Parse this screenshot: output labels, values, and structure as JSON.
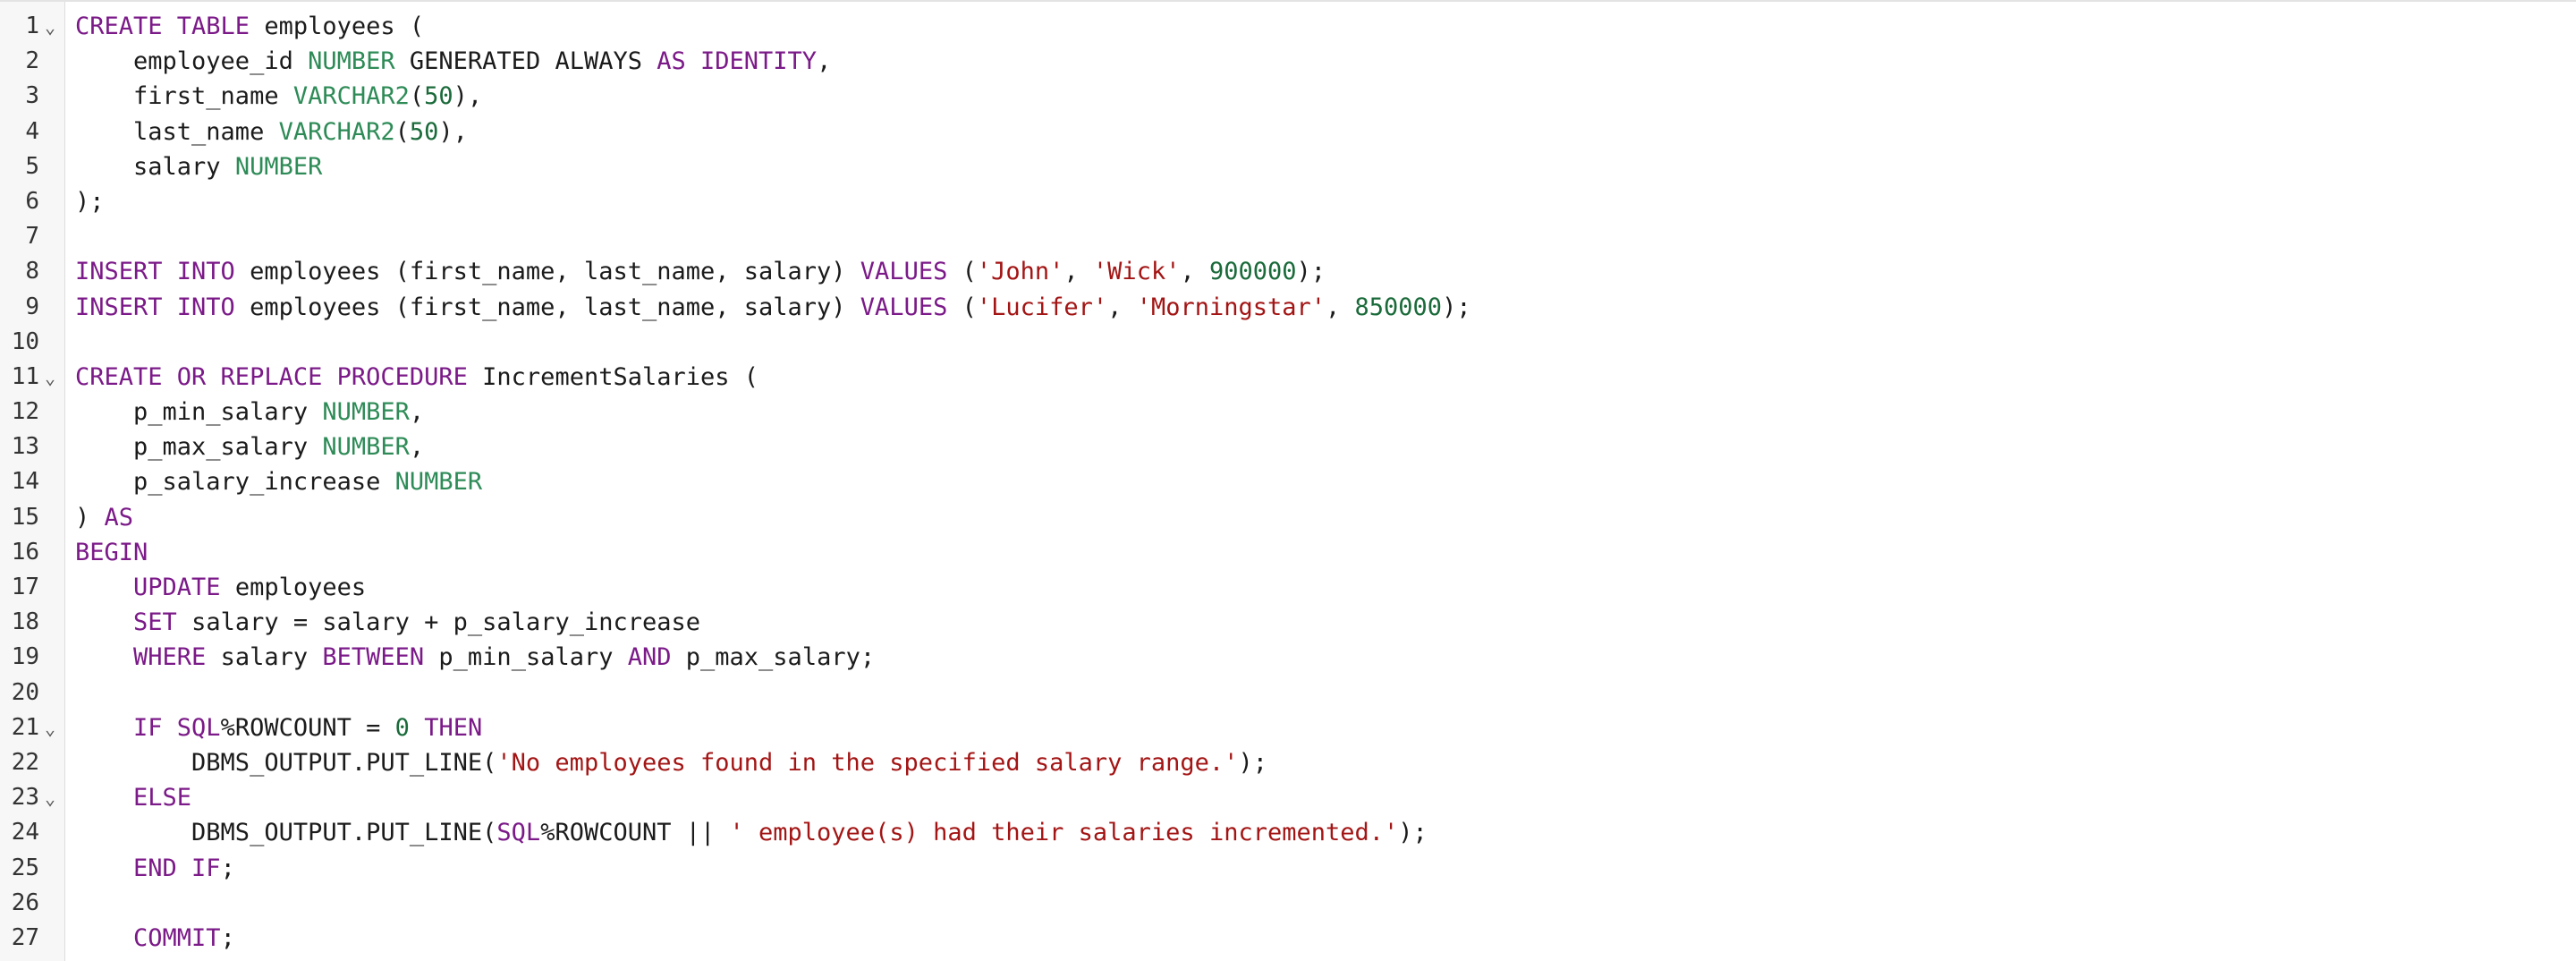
{
  "editor": {
    "fold_glyph": "⌄",
    "lines": [
      {
        "n": "1",
        "fold": true,
        "tokens": [
          {
            "t": "CREATE TABLE",
            "c": "kw"
          },
          {
            "t": " employees (",
            "c": ""
          }
        ]
      },
      {
        "n": "2",
        "fold": false,
        "tokens": [
          {
            "t": "    employee_id ",
            "c": ""
          },
          {
            "t": "NUMBER",
            "c": "ty"
          },
          {
            "t": " GENERATED ALWAYS ",
            "c": ""
          },
          {
            "t": "AS IDENTITY",
            "c": "kw"
          },
          {
            "t": ",",
            "c": ""
          }
        ]
      },
      {
        "n": "3",
        "fold": false,
        "tokens": [
          {
            "t": "    first_name ",
            "c": ""
          },
          {
            "t": "VARCHAR2",
            "c": "ty"
          },
          {
            "t": "(",
            "c": ""
          },
          {
            "t": "50",
            "c": "nu"
          },
          {
            "t": "),",
            "c": ""
          }
        ]
      },
      {
        "n": "4",
        "fold": false,
        "tokens": [
          {
            "t": "    last_name ",
            "c": ""
          },
          {
            "t": "VARCHAR2",
            "c": "ty"
          },
          {
            "t": "(",
            "c": ""
          },
          {
            "t": "50",
            "c": "nu"
          },
          {
            "t": "),",
            "c": ""
          }
        ]
      },
      {
        "n": "5",
        "fold": false,
        "tokens": [
          {
            "t": "    salary ",
            "c": ""
          },
          {
            "t": "NUMBER",
            "c": "ty"
          }
        ]
      },
      {
        "n": "6",
        "fold": false,
        "tokens": [
          {
            "t": ");",
            "c": ""
          }
        ]
      },
      {
        "n": "7",
        "fold": false,
        "tokens": []
      },
      {
        "n": "8",
        "fold": false,
        "tokens": [
          {
            "t": "INSERT INTO",
            "c": "kw"
          },
          {
            "t": " employees (first_name, last_name, salary) ",
            "c": ""
          },
          {
            "t": "VALUES",
            "c": "kw"
          },
          {
            "t": " (",
            "c": ""
          },
          {
            "t": "'John'",
            "c": "st"
          },
          {
            "t": ", ",
            "c": ""
          },
          {
            "t": "'Wick'",
            "c": "st"
          },
          {
            "t": ", ",
            "c": ""
          },
          {
            "t": "900000",
            "c": "nu"
          },
          {
            "t": ");",
            "c": ""
          }
        ]
      },
      {
        "n": "9",
        "fold": false,
        "tokens": [
          {
            "t": "INSERT INTO",
            "c": "kw"
          },
          {
            "t": " employees (first_name, last_name, salary) ",
            "c": ""
          },
          {
            "t": "VALUES",
            "c": "kw"
          },
          {
            "t": " (",
            "c": ""
          },
          {
            "t": "'Lucifer'",
            "c": "st"
          },
          {
            "t": ", ",
            "c": ""
          },
          {
            "t": "'Morningstar'",
            "c": "st"
          },
          {
            "t": ", ",
            "c": ""
          },
          {
            "t": "850000",
            "c": "nu"
          },
          {
            "t": ");",
            "c": ""
          }
        ]
      },
      {
        "n": "10",
        "fold": false,
        "tokens": []
      },
      {
        "n": "11",
        "fold": true,
        "tokens": [
          {
            "t": "CREATE OR REPLACE PROCEDURE",
            "c": "kw"
          },
          {
            "t": " IncrementSalaries (",
            "c": ""
          }
        ]
      },
      {
        "n": "12",
        "fold": false,
        "tokens": [
          {
            "t": "    p_min_salary ",
            "c": ""
          },
          {
            "t": "NUMBER",
            "c": "ty"
          },
          {
            "t": ",",
            "c": ""
          }
        ]
      },
      {
        "n": "13",
        "fold": false,
        "tokens": [
          {
            "t": "    p_max_salary ",
            "c": ""
          },
          {
            "t": "NUMBER",
            "c": "ty"
          },
          {
            "t": ",",
            "c": ""
          }
        ]
      },
      {
        "n": "14",
        "fold": false,
        "tokens": [
          {
            "t": "    p_salary_increase ",
            "c": ""
          },
          {
            "t": "NUMBER",
            "c": "ty"
          }
        ]
      },
      {
        "n": "15",
        "fold": false,
        "tokens": [
          {
            "t": ") ",
            "c": ""
          },
          {
            "t": "AS",
            "c": "kw"
          }
        ]
      },
      {
        "n": "16",
        "fold": false,
        "tokens": [
          {
            "t": "BEGIN",
            "c": "kw"
          }
        ]
      },
      {
        "n": "17",
        "fold": false,
        "tokens": [
          {
            "t": "    ",
            "c": ""
          },
          {
            "t": "UPDATE",
            "c": "kw"
          },
          {
            "t": " employees",
            "c": ""
          }
        ]
      },
      {
        "n": "18",
        "fold": false,
        "tokens": [
          {
            "t": "    ",
            "c": ""
          },
          {
            "t": "SET",
            "c": "kw"
          },
          {
            "t": " salary = salary + p_salary_increase",
            "c": ""
          }
        ]
      },
      {
        "n": "19",
        "fold": false,
        "tokens": [
          {
            "t": "    ",
            "c": ""
          },
          {
            "t": "WHERE",
            "c": "kw"
          },
          {
            "t": " salary ",
            "c": ""
          },
          {
            "t": "BETWEEN",
            "c": "kw"
          },
          {
            "t": " p_min_salary ",
            "c": ""
          },
          {
            "t": "AND",
            "c": "kw"
          },
          {
            "t": " p_max_salary;",
            "c": ""
          }
        ]
      },
      {
        "n": "20",
        "fold": false,
        "tokens": []
      },
      {
        "n": "21",
        "fold": true,
        "tokens": [
          {
            "t": "    ",
            "c": ""
          },
          {
            "t": "IF SQL",
            "c": "kw"
          },
          {
            "t": "%ROWCOUNT = ",
            "c": ""
          },
          {
            "t": "0",
            "c": "nu"
          },
          {
            "t": " ",
            "c": ""
          },
          {
            "t": "THEN",
            "c": "kw"
          }
        ]
      },
      {
        "n": "22",
        "fold": false,
        "tokens": [
          {
            "t": "        DBMS_OUTPUT.PUT_LINE(",
            "c": ""
          },
          {
            "t": "'No employees found in the specified salary range.'",
            "c": "st"
          },
          {
            "t": ");",
            "c": ""
          }
        ]
      },
      {
        "n": "23",
        "fold": true,
        "tokens": [
          {
            "t": "    ",
            "c": ""
          },
          {
            "t": "ELSE",
            "c": "kw"
          }
        ]
      },
      {
        "n": "24",
        "fold": false,
        "tokens": [
          {
            "t": "        DBMS_OUTPUT.PUT_LINE(",
            "c": ""
          },
          {
            "t": "SQL",
            "c": "kw"
          },
          {
            "t": "%ROWCOUNT || ",
            "c": ""
          },
          {
            "t": "' employee(s) had their salaries incremented.'",
            "c": "st"
          },
          {
            "t": ");",
            "c": ""
          }
        ]
      },
      {
        "n": "25",
        "fold": false,
        "tokens": [
          {
            "t": "    ",
            "c": ""
          },
          {
            "t": "END IF",
            "c": "kw"
          },
          {
            "t": ";",
            "c": ""
          }
        ]
      },
      {
        "n": "26",
        "fold": false,
        "tokens": []
      },
      {
        "n": "27",
        "fold": false,
        "tokens": [
          {
            "t": "    ",
            "c": ""
          },
          {
            "t": "COMMIT",
            "c": "kw"
          },
          {
            "t": ";",
            "c": ""
          }
        ]
      }
    ]
  }
}
